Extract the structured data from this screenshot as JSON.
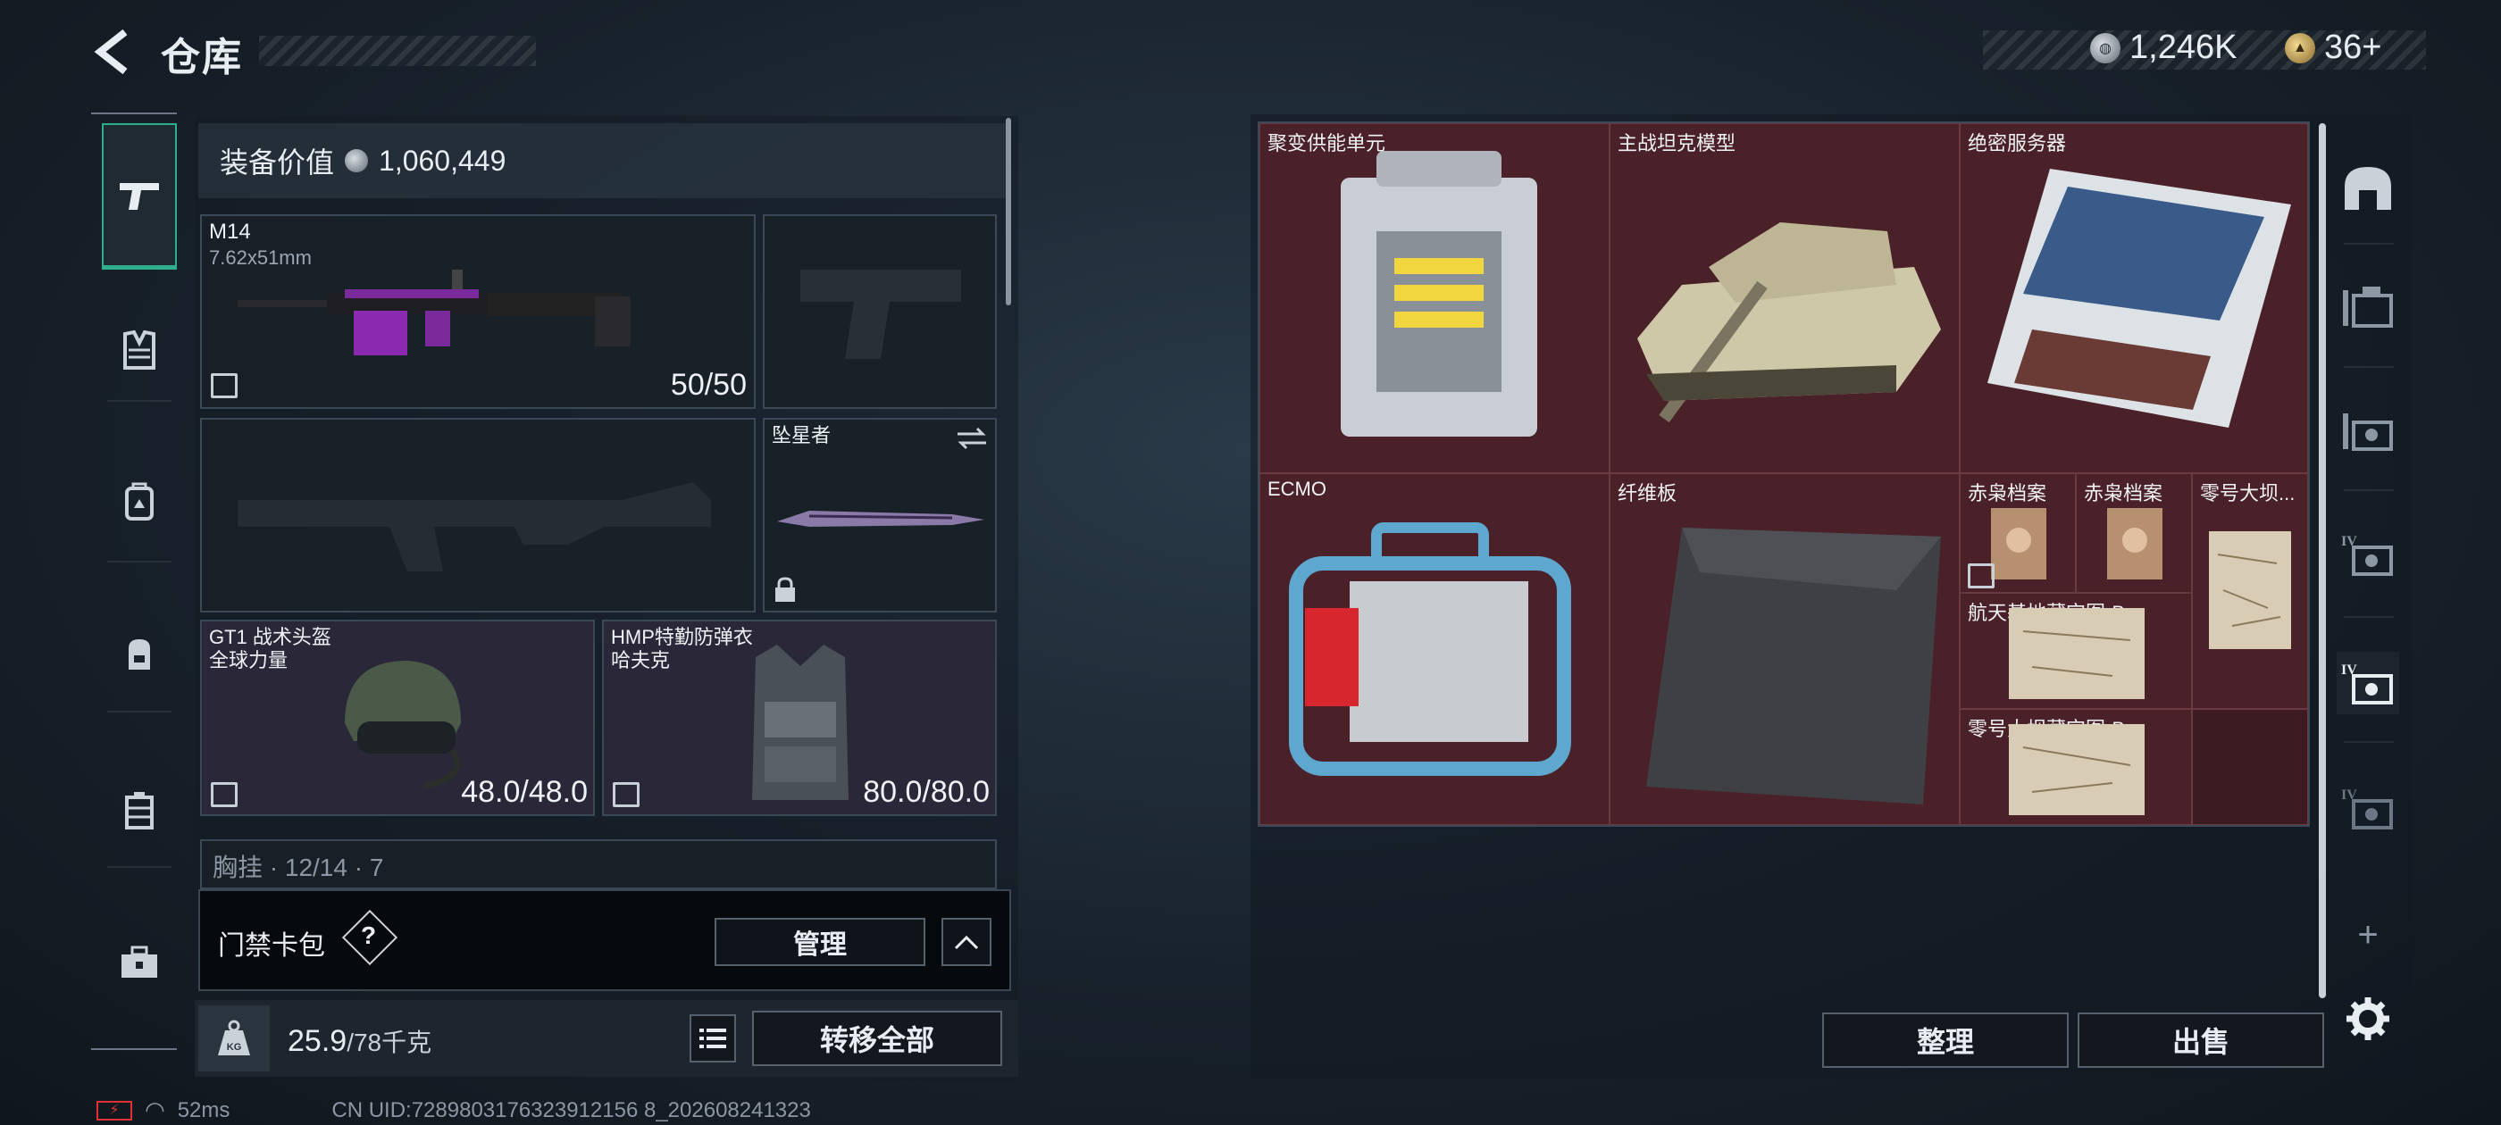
{
  "header": {
    "title": "仓库"
  },
  "currency": {
    "coins": "1,246K",
    "gold": "36+"
  },
  "equipment": {
    "value_label": "装备价值",
    "value": "1,060,449"
  },
  "weapon_primary": {
    "name": "M14",
    "caliber": "7.62x51mm",
    "ammo": "50/50"
  },
  "melee": {
    "name": "坠星者"
  },
  "helmet": {
    "name": "GT1 战术头盔",
    "brand": "全球力量",
    "durability": "48.0/48.0"
  },
  "armor": {
    "name": "HMP特勤防弹衣",
    "brand": "哈夫克",
    "durability": "80.0/80.0"
  },
  "chest_rig": {
    "label": "胸挂 · 12/14 · 7"
  },
  "card_pack": {
    "label": "门禁卡包",
    "help": "?",
    "manage": "管理"
  },
  "weight": {
    "current": "25.9",
    "max": "/78千克",
    "kg_icon": "KG"
  },
  "transfer_all": "转移全部",
  "status": {
    "ping": "52ms",
    "uid": "CN UID:7289803176323912156 8_202608241323"
  },
  "stash": {
    "items": [
      {
        "name": "聚变供能单元"
      },
      {
        "name": "主战坦克模型"
      },
      {
        "name": "绝密服务器"
      },
      {
        "name": "ECMO"
      },
      {
        "name": "纤维板"
      },
      {
        "name": "赤枭档案"
      },
      {
        "name": "赤枭档案"
      },
      {
        "name": "零号大坝..."
      },
      {
        "name": "航天基地藏宝图-B"
      },
      {
        "name": "零号大坝藏宝图-B"
      }
    ],
    "sort": "整理",
    "sell": "出售"
  },
  "colors": {
    "accent": "#2fae8c",
    "stash_bg": "#4a2128"
  }
}
